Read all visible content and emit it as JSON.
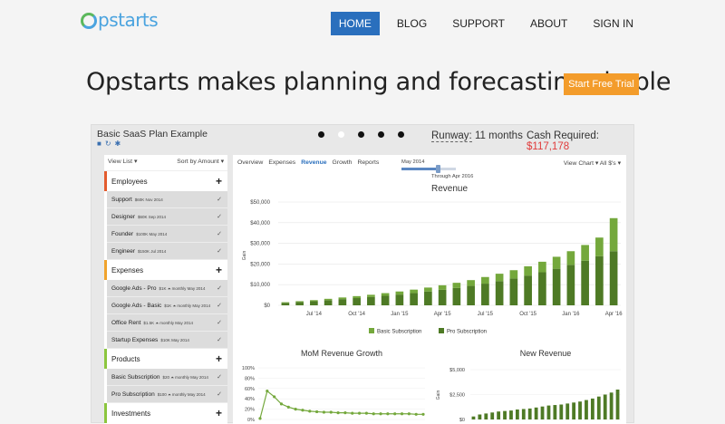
{
  "nav": {
    "logo": "Opstarts",
    "items": [
      {
        "label": "HOME",
        "active": true
      },
      {
        "label": "BLOG",
        "active": false
      },
      {
        "label": "SUPPORT",
        "active": false
      },
      {
        "label": "ABOUT",
        "active": false
      },
      {
        "label": "SIGN IN",
        "active": false
      }
    ]
  },
  "hero": {
    "headline": "Opstarts makes planning and forecasting simple",
    "cta": "Start Free Trial"
  },
  "colors": {
    "accent": "#2a6fbd",
    "cta": "#f39c2b",
    "cash": "#e03a3a",
    "basic": "#74a83c",
    "pro": "#4e7a25"
  },
  "app": {
    "plan_title": "Basic SaaS Plan Example",
    "carousel_dots": 5,
    "runway_label": "Runway:",
    "runway_value": "11",
    "runway_unit": "months",
    "cash_label": "Cash Required:",
    "cash_value": "$117,178",
    "left_header": {
      "view_list": "View List ▾",
      "sort": "Sort by Amount ▾"
    },
    "categories": [
      {
        "label": "Employees",
        "color": "#e35b2d",
        "rows": [
          {
            "name": "Support",
            "meta": "$60K Nov 2014"
          },
          {
            "name": "Designer",
            "meta": "$60K Sep 2014"
          },
          {
            "name": "Founder",
            "meta": "$100K May 2014"
          },
          {
            "name": "Engineer",
            "meta": "$150K Jul 2014"
          }
        ]
      },
      {
        "label": "Expenses",
        "color": "#f0a32c",
        "rows": [
          {
            "name": "Google Ads - Pro",
            "meta": "$1K ⏶ monthly May 2014"
          },
          {
            "name": "Google Ads - Basic",
            "meta": "$1K ⏶ monthly May 2014"
          },
          {
            "name": "Office Rent",
            "meta": "$1.5K ⏶ monthly May 2014"
          },
          {
            "name": "Startup Expenses",
            "meta": "$10K May 2014"
          }
        ]
      },
      {
        "label": "Products",
        "color": "#8cc63e",
        "rows": [
          {
            "name": "Basic Subscription",
            "meta": "$20 ⏶ monthly May 2014"
          },
          {
            "name": "Pro Subscription",
            "meta": "$100 ⏶ monthly May 2014"
          }
        ]
      },
      {
        "label": "Investments",
        "color": "#8cc63e",
        "rows": []
      }
    ],
    "tabs": [
      "Overview",
      "Expenses",
      "Revenue",
      "Growth",
      "Reports"
    ],
    "active_tab": "Revenue",
    "slider_start": "May 2014",
    "slider_end": "Through Apr 2016",
    "slider_level": 0.68,
    "view_chart": "View Chart ▾ All $'s ▾"
  },
  "chart_data": [
    {
      "type": "bar",
      "title": "Revenue",
      "ylabel": "Gain",
      "ylim": [
        0,
        50000
      ],
      "yticks": [
        "$0",
        "$10,000",
        "$20,000",
        "$30,000",
        "$40,000",
        "$50,000"
      ],
      "xticks": [
        "Jul '14",
        "Oct '14",
        "Jan '15",
        "Apr '15",
        "Jul '15",
        "Oct '15",
        "Jan '16",
        "Apr '16"
      ],
      "categories": [
        "May '14",
        "Jun '14",
        "Jul '14",
        "Aug '14",
        "Sep '14",
        "Oct '14",
        "Nov '14",
        "Dec '14",
        "Jan '15",
        "Feb '15",
        "Mar '15",
        "Apr '15",
        "May '15",
        "Jun '15",
        "Jul '15",
        "Aug '15",
        "Sep '15",
        "Oct '15",
        "Nov '15",
        "Dec '15",
        "Jan '16",
        "Feb '16",
        "Mar '16",
        "Apr '16"
      ],
      "series": [
        {
          "name": "Pro Subscription",
          "values": [
            1200,
            1600,
            2000,
            2500,
            3000,
            3500,
            4000,
            4600,
            5200,
            5900,
            6700,
            7500,
            8400,
            9400,
            10500,
            11700,
            13000,
            14400,
            16000,
            17700,
            19600,
            21600,
            23800,
            26200
          ]
        },
        {
          "name": "Basic Subscription",
          "values": [
            300,
            400,
            500,
            650,
            800,
            950,
            1100,
            1300,
            1500,
            1700,
            1900,
            2200,
            2500,
            2800,
            3200,
            3600,
            4000,
            4500,
            5100,
            5800,
            6600,
            7600,
            9000,
            16000
          ]
        }
      ],
      "legend": "bottom"
    },
    {
      "type": "line",
      "title": "MoM Revenue Growth",
      "ylim": [
        0,
        100
      ],
      "yticks": [
        "0%",
        "20%",
        "40%",
        "60%",
        "80%",
        "100%"
      ],
      "xticks": [
        "Jul '14",
        "Jan '15",
        "Jul '15",
        "Jan '16"
      ],
      "values": [
        2,
        55,
        44,
        30,
        24,
        20,
        18,
        16,
        15,
        14,
        14,
        13,
        13,
        12,
        12,
        12,
        11,
        11,
        11,
        11,
        11,
        11,
        10,
        10
      ]
    },
    {
      "type": "bar",
      "title": "New Revenue",
      "ylabel": "Gain",
      "ylim": [
        0,
        5000
      ],
      "yticks": [
        "$0",
        "$2,500",
        "$5,000"
      ],
      "xticks": [
        "Jul '14",
        "Jan '15",
        "Jul '15",
        "Jan '16"
      ],
      "values": [
        300,
        500,
        600,
        700,
        800,
        850,
        900,
        1000,
        1050,
        1100,
        1200,
        1300,
        1400,
        1450,
        1500,
        1600,
        1700,
        1800,
        1950,
        2100,
        2300,
        2500,
        2700,
        3000
      ]
    }
  ]
}
